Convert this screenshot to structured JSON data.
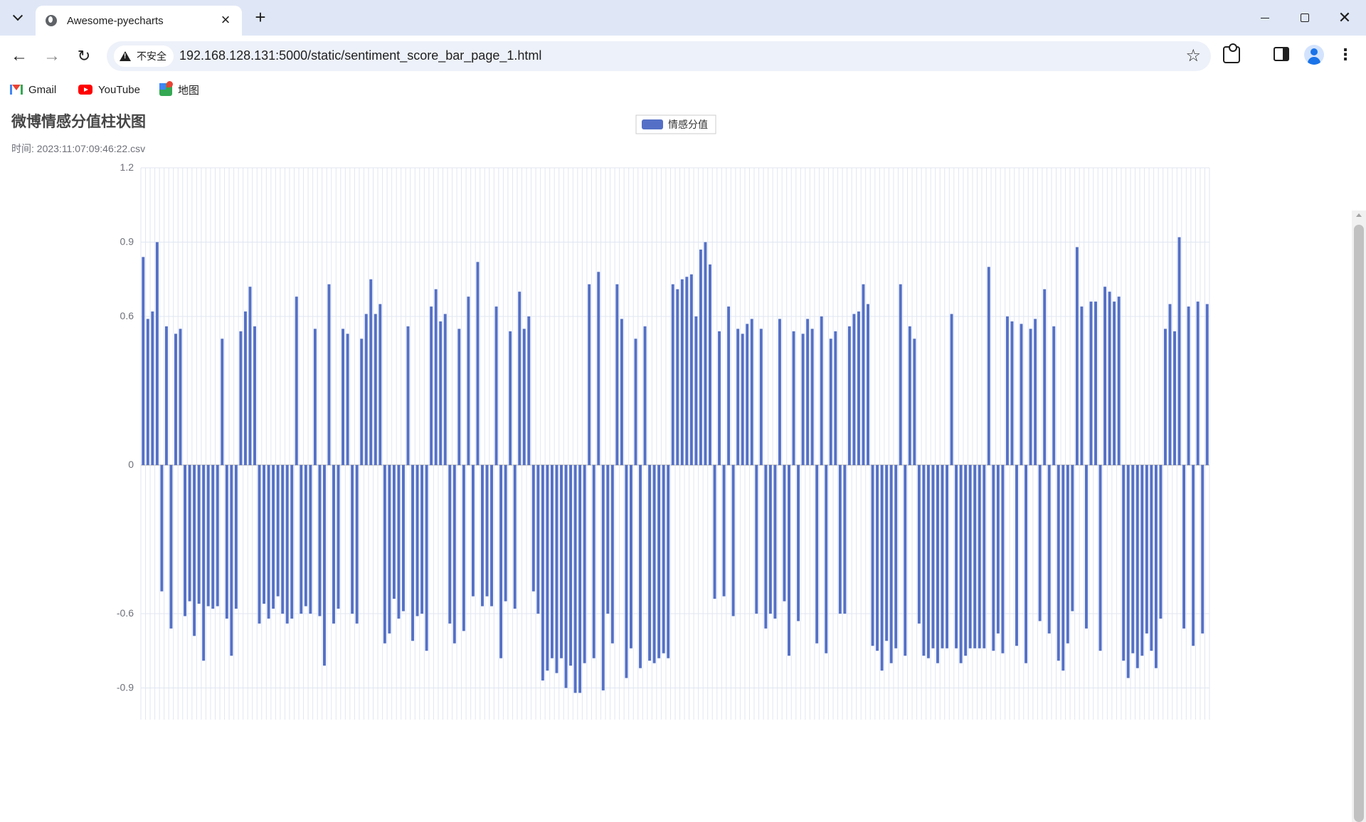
{
  "browser": {
    "tab_title": "Awesome-pyecharts",
    "security_label": "不安全",
    "url": "192.168.128.131:5000/static/sentiment_score_bar_page_1.html",
    "bookmarks": [
      {
        "label": "Gmail",
        "icon": "gmail-icon"
      },
      {
        "label": "YouTube",
        "icon": "youtube-icon"
      },
      {
        "label": "地图",
        "icon": "maps-icon"
      }
    ]
  },
  "colors": {
    "bar": "#5470c6",
    "axis_label": "#6e7079",
    "grid": "#e0e6f1",
    "title": "#464646"
  },
  "chart_data": {
    "type": "bar",
    "title": "微博情感分值柱状图",
    "subtitle": "时间: 2023:11:07:09:46:22.csv",
    "legend": [
      "情感分值"
    ],
    "legend_position": "top-center",
    "ylim": [
      -0.9,
      1.2
    ],
    "yticks": [
      -0.9,
      -0.6,
      0,
      0.6,
      0.9,
      1.2
    ],
    "series": [
      {
        "name": "情感分值",
        "values": [
          0.84,
          0.59,
          0.62,
          0.9,
          -0.51,
          0.56,
          -0.66,
          0.53,
          0.55,
          -0.61,
          -0.55,
          -0.69,
          -0.56,
          -0.79,
          -0.57,
          -0.58,
          -0.57,
          0.51,
          -0.62,
          -0.77,
          -0.58,
          0.54,
          0.62,
          0.72,
          0.56,
          -0.64,
          -0.56,
          -0.62,
          -0.58,
          -0.53,
          -0.6,
          -0.64,
          -0.62,
          0.68,
          -0.6,
          -0.57,
          -0.6,
          0.55,
          -0.61,
          -0.81,
          0.73,
          -0.64,
          -0.58,
          0.55,
          0.53,
          -0.6,
          -0.64,
          0.51,
          0.61,
          0.75,
          0.61,
          0.65,
          -0.72,
          -0.68,
          -0.54,
          -0.62,
          -0.59,
          0.56,
          -0.71,
          -0.61,
          -0.6,
          -0.75,
          0.64,
          0.71,
          0.58,
          0.61,
          -0.64,
          -0.72,
          0.55,
          -0.67,
          0.68,
          -0.53,
          0.82,
          -0.57,
          -0.53,
          -0.57,
          0.64,
          -0.78,
          -0.55,
          0.54,
          -0.58,
          0.7,
          0.55,
          0.6,
          -0.51,
          -0.6,
          -0.87,
          -0.83,
          -0.78,
          -0.84,
          -0.78,
          -0.9,
          -0.81,
          -0.92,
          -0.92,
          -0.8,
          0.73,
          -0.78,
          0.78,
          -0.91,
          -0.6,
          -0.72,
          0.73,
          0.59,
          -0.86,
          -0.74,
          0.51,
          -0.82,
          0.56,
          -0.79,
          -0.8,
          -0.78,
          -0.76,
          -0.78,
          0.73,
          0.71,
          0.75,
          0.76,
          0.77,
          0.6,
          0.87,
          0.9,
          0.81,
          -0.54,
          0.54,
          -0.53,
          0.64,
          -0.61,
          0.55,
          0.53,
          0.57,
          0.59,
          -0.6,
          0.55,
          -0.66,
          -0.6,
          -0.62,
          0.59,
          -0.55,
          -0.77,
          0.54,
          -0.63,
          0.53,
          0.59,
          0.55,
          -0.72,
          0.6,
          -0.76,
          0.51,
          0.54,
          -0.6,
          -0.6,
          0.56,
          0.61,
          0.62,
          0.73,
          0.65,
          -0.73,
          -0.75,
          -0.83,
          -0.71,
          -0.8,
          -0.74,
          0.73,
          -0.77,
          0.56,
          0.51,
          -0.64,
          -0.77,
          -0.78,
          -0.74,
          -0.8,
          -0.74,
          -0.74,
          0.61,
          -0.74,
          -0.8,
          -0.77,
          -0.74,
          -0.74,
          -0.74,
          -0.74,
          0.8,
          -0.75,
          -0.68,
          -0.76,
          0.6,
          0.58,
          -0.73,
          0.57,
          -0.8,
          0.55,
          0.59,
          -0.63,
          0.71,
          -0.68,
          0.56,
          -0.79,
          -0.83,
          -0.72,
          -0.59,
          0.88,
          0.64,
          -0.66,
          0.66,
          0.66,
          -0.75,
          0.72,
          0.7,
          0.66,
          0.68,
          -0.79,
          -0.86,
          -0.76,
          -0.82,
          -0.77,
          -0.68,
          -0.75,
          -0.82,
          -0.62,
          0.55,
          0.65,
          0.54,
          0.92,
          -0.66,
          0.64,
          -0.73,
          0.66,
          -0.68,
          0.65
        ]
      }
    ]
  }
}
